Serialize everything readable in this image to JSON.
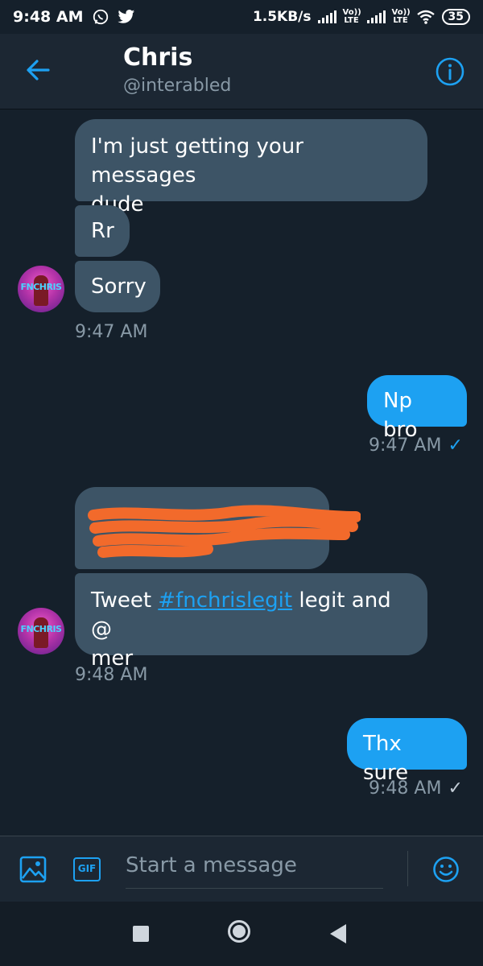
{
  "status_bar": {
    "time": "9:48 AM",
    "speed": "1.5KB/s",
    "lte1": "Vo)) LTE",
    "lte2": "Vo)) LTE",
    "battery": "35"
  },
  "header": {
    "name": "Chris",
    "handle": "@interabled"
  },
  "messages": {
    "in1_line1": "I'm just getting your messages",
    "in1_line2": "dude",
    "in2": "Rr",
    "in3": "Sorry",
    "ts1": "9:47 AM",
    "out1": "Np bro",
    "ts2": "9:47 AM",
    "in5_prefix": "Tweet ",
    "in5_link": "#fnchrislegit",
    "in5_suffix": " legit and @",
    "in5_line2": "mer",
    "ts3": "9:48 AM",
    "out2": "Thx sure",
    "ts4": "9:48 AM",
    "check": "✓"
  },
  "avatar": {
    "text": "FNCHRIS"
  },
  "composer": {
    "placeholder": "Start a message",
    "gif_label": "GIF"
  },
  "colors": {
    "background": "#15202b",
    "accent": "#1da1f2",
    "incoming_bubble": "#3d5466",
    "redaction": "#f26a2b"
  }
}
